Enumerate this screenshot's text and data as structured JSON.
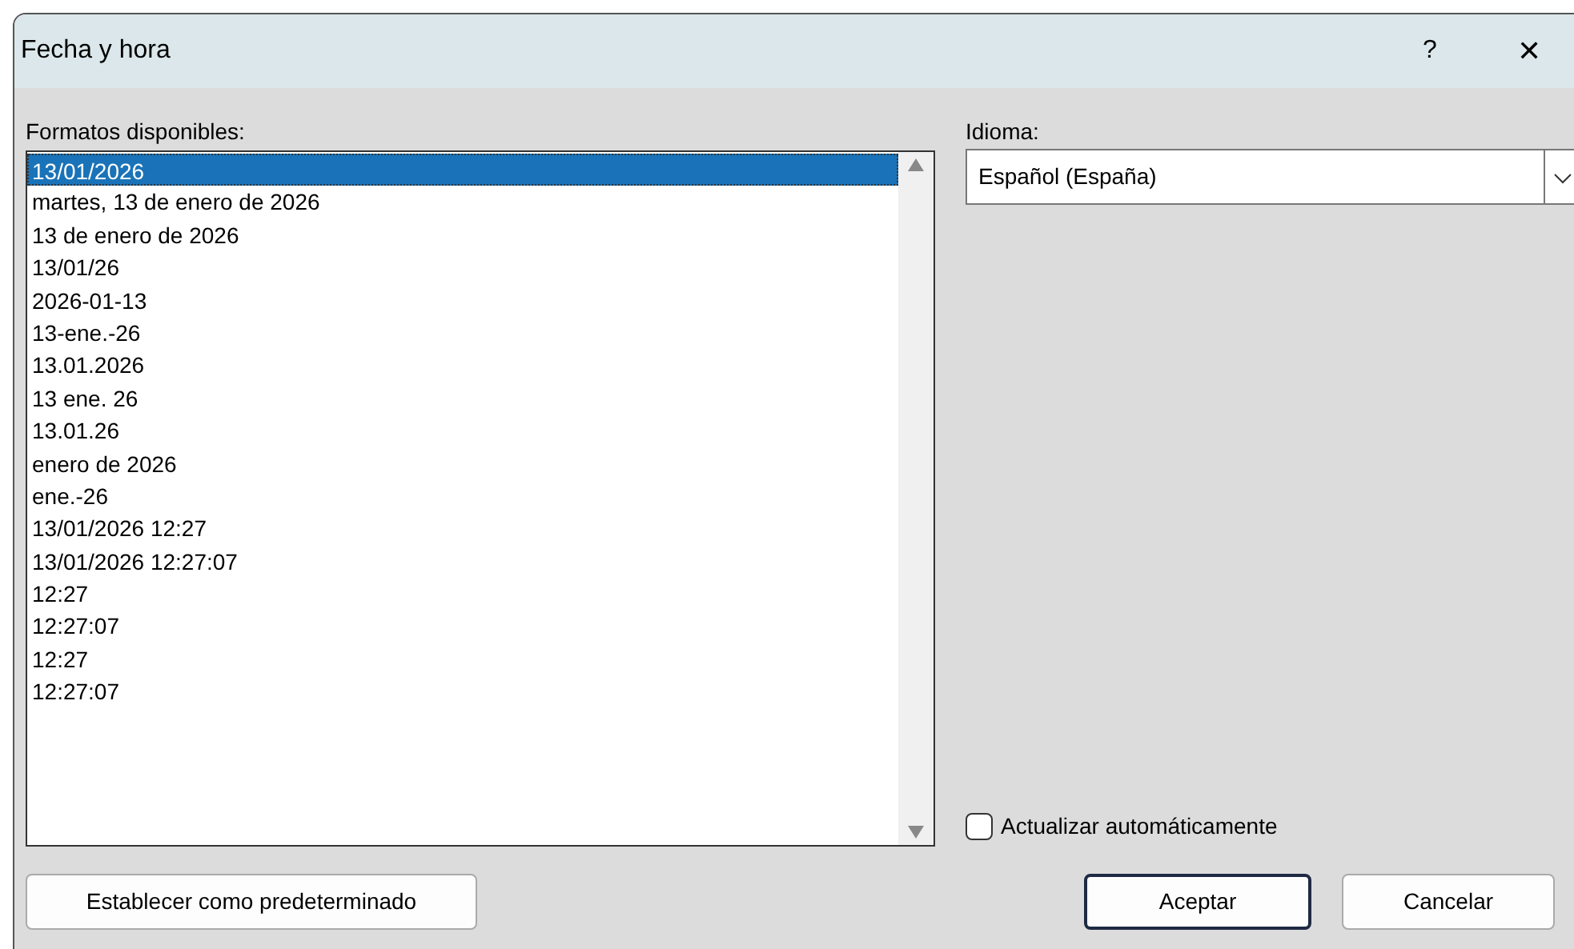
{
  "window": {
    "title": "Fecha y hora",
    "help": "?",
    "close": "✕"
  },
  "formats": {
    "label": "Formatos disponibles:",
    "items": [
      {
        "text": "13/01/2026",
        "selected": true
      },
      {
        "text": "martes, 13 de enero de 2026",
        "selected": false
      },
      {
        "text": "13 de enero de 2026",
        "selected": false
      },
      {
        "text": "13/01/26",
        "selected": false
      },
      {
        "text": "2026-01-13",
        "selected": false
      },
      {
        "text": "13-ene.-26",
        "selected": false
      },
      {
        "text": "13.01.2026",
        "selected": false
      },
      {
        "text": "13 ene. 26",
        "selected": false
      },
      {
        "text": "13.01.26",
        "selected": false
      },
      {
        "text": "enero de 2026",
        "selected": false
      },
      {
        "text": "ene.-26",
        "selected": false
      },
      {
        "text": "13/01/2026 12:27",
        "selected": false
      },
      {
        "text": "13/01/2026 12:27:07",
        "selected": false
      },
      {
        "text": "12:27",
        "selected": false
      },
      {
        "text": "12:27:07",
        "selected": false
      },
      {
        "text": "12:27",
        "selected": false
      },
      {
        "text": "12:27:07",
        "selected": false
      }
    ]
  },
  "language": {
    "label": "Idioma:",
    "value": "Español (España)"
  },
  "auto_update": {
    "label": "Actualizar automáticamente",
    "checked": false
  },
  "buttons": {
    "set_default": "Establecer como predeterminado",
    "ok": "Aceptar",
    "cancel": "Cancelar"
  }
}
